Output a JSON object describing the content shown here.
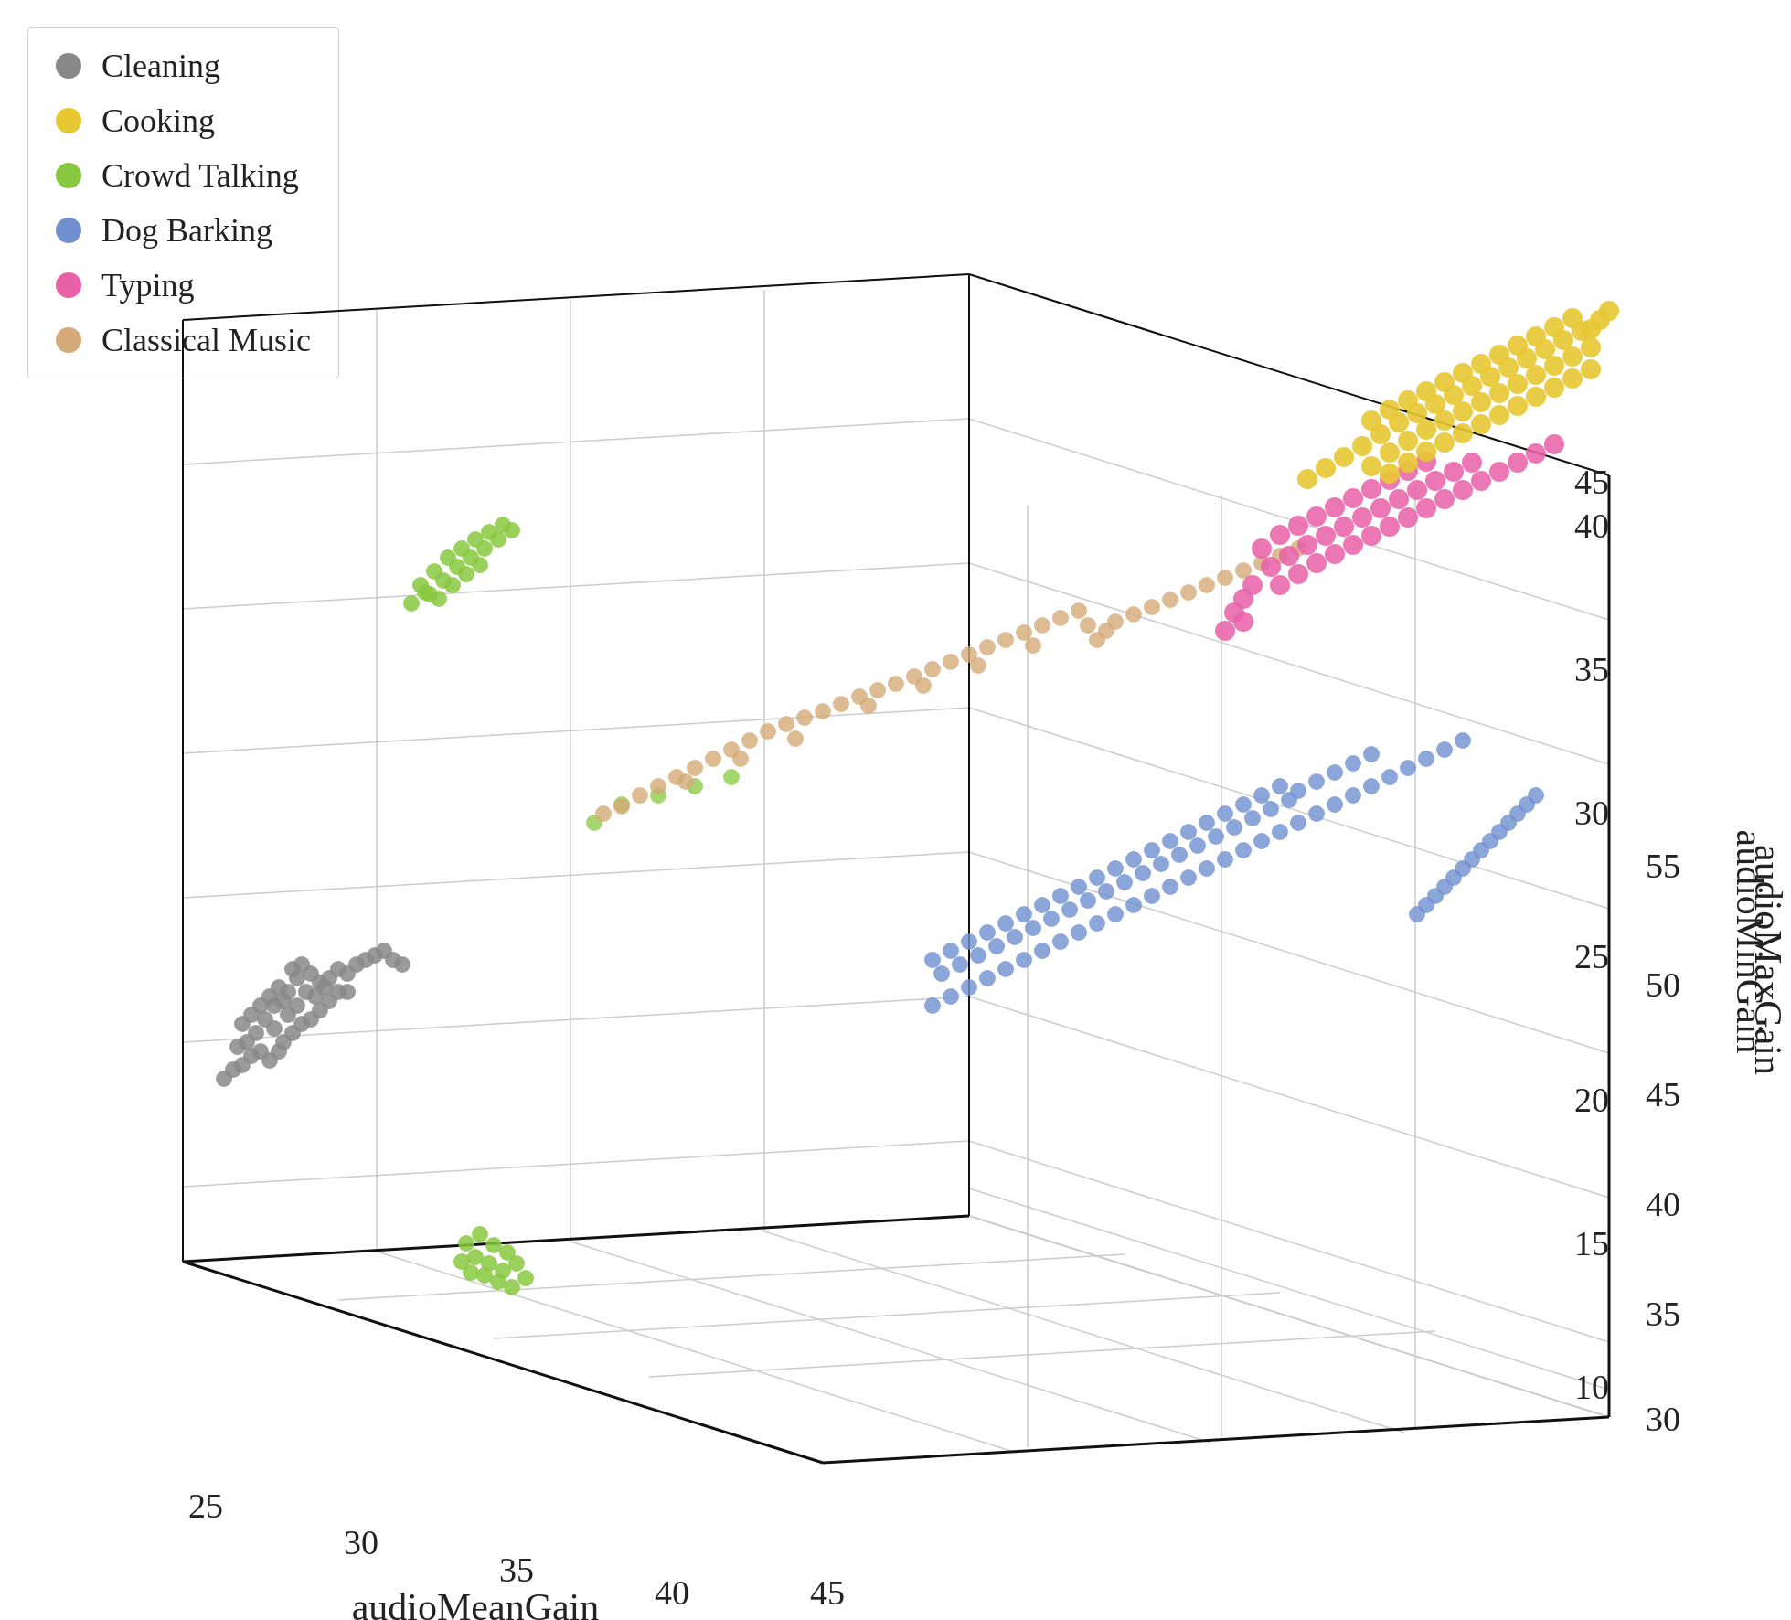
{
  "legend": {
    "items": [
      {
        "label": "Cleaning",
        "color": "#888888"
      },
      {
        "label": "Cooking",
        "color": "#e8c832"
      },
      {
        "label": "Crowd Talking",
        "color": "#88c840"
      },
      {
        "label": "Dog Barking",
        "color": "#7090d0"
      },
      {
        "label": "Typing",
        "color": "#e860a8"
      },
      {
        "label": "Classical Music",
        "color": "#d4aa78"
      }
    ]
  },
  "axes": {
    "x_label": "audioMeanGain",
    "y_label": "audioMinGain",
    "z_label": "audioMaxGain",
    "x_ticks": [
      "25",
      "30",
      "35",
      "40",
      "45"
    ],
    "y_ticks": [
      "10",
      "15",
      "20",
      "25",
      "30",
      "35",
      "40",
      "45"
    ],
    "z_ticks": [
      "30",
      "35",
      "40",
      "45",
      "50",
      "55"
    ]
  }
}
